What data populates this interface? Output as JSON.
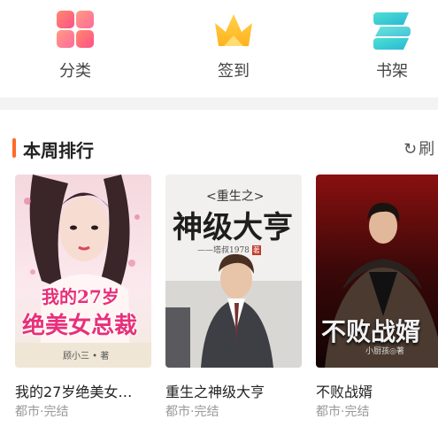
{
  "quick_nav": {
    "items": [
      {
        "label": "分类",
        "icon": "grid-category-icon"
      },
      {
        "label": "签到",
        "icon": "crown-icon"
      },
      {
        "label": "书架",
        "icon": "bookshelf-icon"
      }
    ]
  },
  "section": {
    "title": "本周排行",
    "refresh_label": "刷",
    "refresh_icon": "refresh-icon"
  },
  "books": [
    {
      "title": "我的27岁绝美女…",
      "meta": "都市·完结",
      "cover_title_line1": "我的27岁",
      "cover_title_line2": "绝美女总裁",
      "cover_author": "顾小三 • 著"
    },
    {
      "title": "重生之神级大亨",
      "meta": "都市·完结",
      "cover_prefix": "<重生之>",
      "cover_title": "神级大亨",
      "cover_author": "——塔叔1978",
      "cover_author_mark": "著"
    },
    {
      "title": "不败战婿",
      "meta": "都市·完结",
      "cover_title": "不败战婿",
      "cover_author": "小厨孩◎著"
    }
  ],
  "colors": {
    "accent": "#ff6a2b",
    "meta_text": "#999999",
    "divider": "#f3f3f3"
  }
}
